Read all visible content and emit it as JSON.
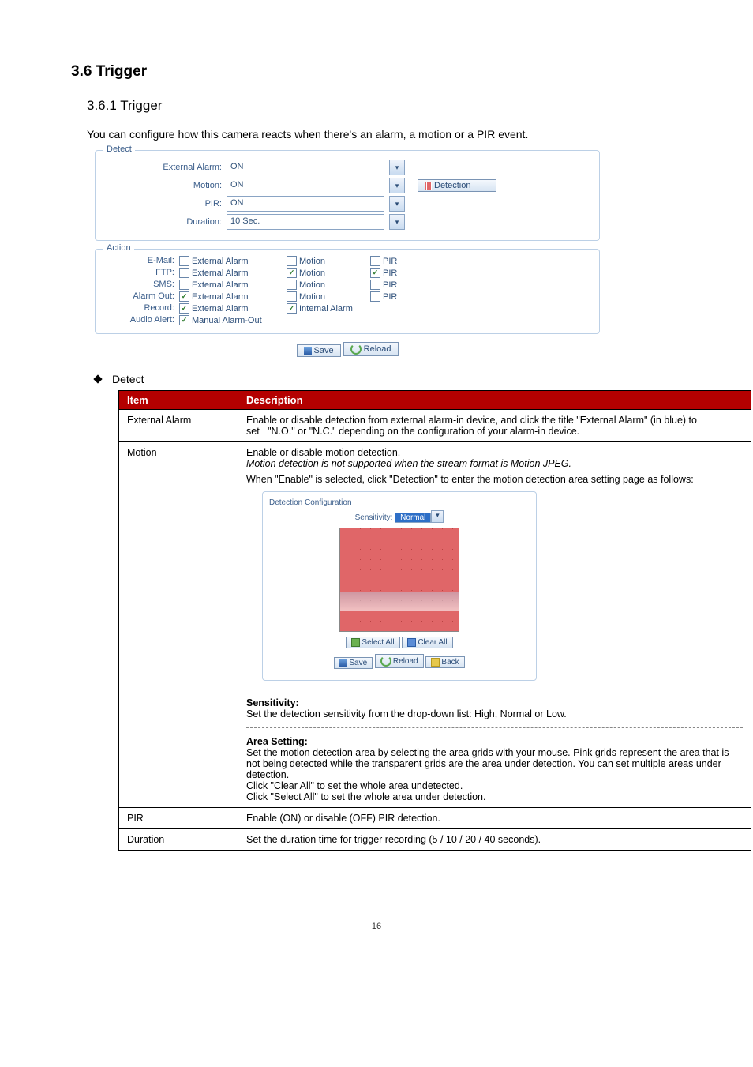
{
  "headings": {
    "section": "3.6 Trigger",
    "subsection": "3.6.1 Trigger",
    "intro": "You can configure how this camera reacts when there's an alarm, a motion or a PIR event."
  },
  "detect": {
    "panel_title": "Detect",
    "rows": {
      "external_alarm": {
        "label": "External Alarm:",
        "value": "ON"
      },
      "motion": {
        "label": "Motion:",
        "value": "ON",
        "button": "Detection"
      },
      "pir": {
        "label": "PIR:",
        "value": "ON"
      },
      "duration": {
        "label": "Duration:",
        "value": "10 Sec."
      }
    }
  },
  "action": {
    "panel_title": "Action",
    "cols": {
      "ext": "External Alarm",
      "motion": "Motion",
      "pir": "PIR",
      "internal": "Internal Alarm",
      "manual": "Manual Alarm-Out"
    },
    "rows": [
      {
        "label": "E-Mail:",
        "ext": false,
        "motion": false,
        "pir": false
      },
      {
        "label": "FTP:",
        "ext": false,
        "motion": true,
        "pir": true
      },
      {
        "label": "SMS:",
        "ext": false,
        "motion": false,
        "pir": false
      },
      {
        "label": "Alarm Out:",
        "ext": true,
        "motion": false,
        "pir": false
      },
      {
        "label": "Record:",
        "ext": true,
        "internal": true
      },
      {
        "label": "Audio Alert:",
        "manual": true
      }
    ],
    "save": "Save",
    "reload": "Reload"
  },
  "bullet": {
    "detect_label": "Detect"
  },
  "table": {
    "header_item": "Item",
    "header_desc": "Description",
    "external_alarm": {
      "item": "External Alarm",
      "desc": "Enable or disable detection from external alarm-in device, and click the title \"External Alarm\" (in blue) to set   \"N.O.\" or \"N.C.\" depending on the configuration of your alarm-in device."
    },
    "motion": {
      "item": "Motion",
      "l1": "Enable or disable motion detection.",
      "l2": "Motion detection is not supported when the stream format is Motion JPEG.",
      "l3": "When \"Enable\" is selected, click \"Detection\" to enter the motion detection area setting page as follows:",
      "config": {
        "title": "Detection Configuration",
        "sens_label": "Sensitivity:",
        "sens_value": "Normal",
        "select_all": "Select All",
        "clear_all": "Clear All",
        "save": "Save",
        "reload": "Reload",
        "back": "Back"
      },
      "sens_header": "Sensitivity:",
      "sens_text": "Set the detection sensitivity from the drop-down list: High, Normal or Low.",
      "area_header": "Area Setting:",
      "area_p1": "Set the motion detection area by selecting the area grids with your mouse. Pink grids represent the area that is not being detected while the transparent grids are the area under detection. You can set multiple areas under detection.",
      "area_p2": "Click \"Clear All\" to set the whole area undetected.",
      "area_p3": "Click \"Select All\" to set the whole area under detection."
    },
    "pir": {
      "item": "PIR",
      "desc": "Enable (ON) or disable (OFF) PIR detection."
    },
    "duration": {
      "item": "Duration",
      "desc": "Set the duration time for trigger recording (5 / 10 / 20 / 40 seconds)."
    }
  },
  "page_number": "16"
}
